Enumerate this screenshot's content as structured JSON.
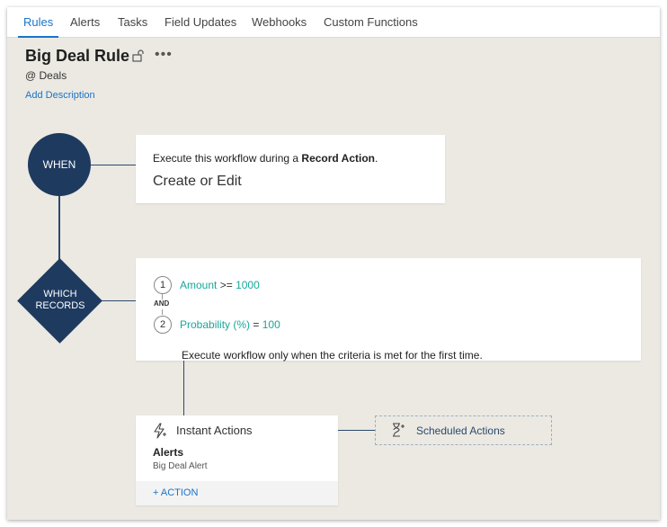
{
  "tabs": [
    {
      "label": "Rules",
      "active": true
    },
    {
      "label": "Alerts",
      "active": false
    },
    {
      "label": "Tasks",
      "active": false
    },
    {
      "label": "Field Updates",
      "active": false
    },
    {
      "label": "Webhooks",
      "active": false
    },
    {
      "label": "Custom Functions",
      "active": false
    }
  ],
  "rule": {
    "title": "Big Deal Rule",
    "more_label": "•••",
    "module": "@ Deals",
    "add_description": "Add Description"
  },
  "when": {
    "node_label": "WHEN",
    "description_prefix": "Execute this workflow during a",
    "description_bold": "Record Action",
    "description_suffix": ".",
    "value": "Create or Edit"
  },
  "which_records": {
    "node_label_line1": "WHICH",
    "node_label_line2": "RECORDS",
    "criteria": [
      {
        "number": "1",
        "field": "Amount",
        "operator": ">=",
        "value": "1000"
      },
      {
        "number": "2",
        "field": "Probability (%)",
        "operator": "=",
        "value": "100"
      }
    ],
    "joiner": "AND",
    "note": "Execute workflow only when the criteria is met for the first time."
  },
  "instant_actions": {
    "label": "Instant Actions",
    "icon": "lightning-icon",
    "group_title": "Alerts",
    "items": [
      "Big Deal Alert"
    ],
    "add_action_label": "+ ACTION"
  },
  "scheduled_actions": {
    "label": "Scheduled Actions",
    "icon": "hourglass-plus-icon"
  },
  "colors": {
    "accent": "#1a73c8",
    "node": "#1e3a5f",
    "criteria_value": "#18a79a",
    "background": "#ebe9e2"
  }
}
